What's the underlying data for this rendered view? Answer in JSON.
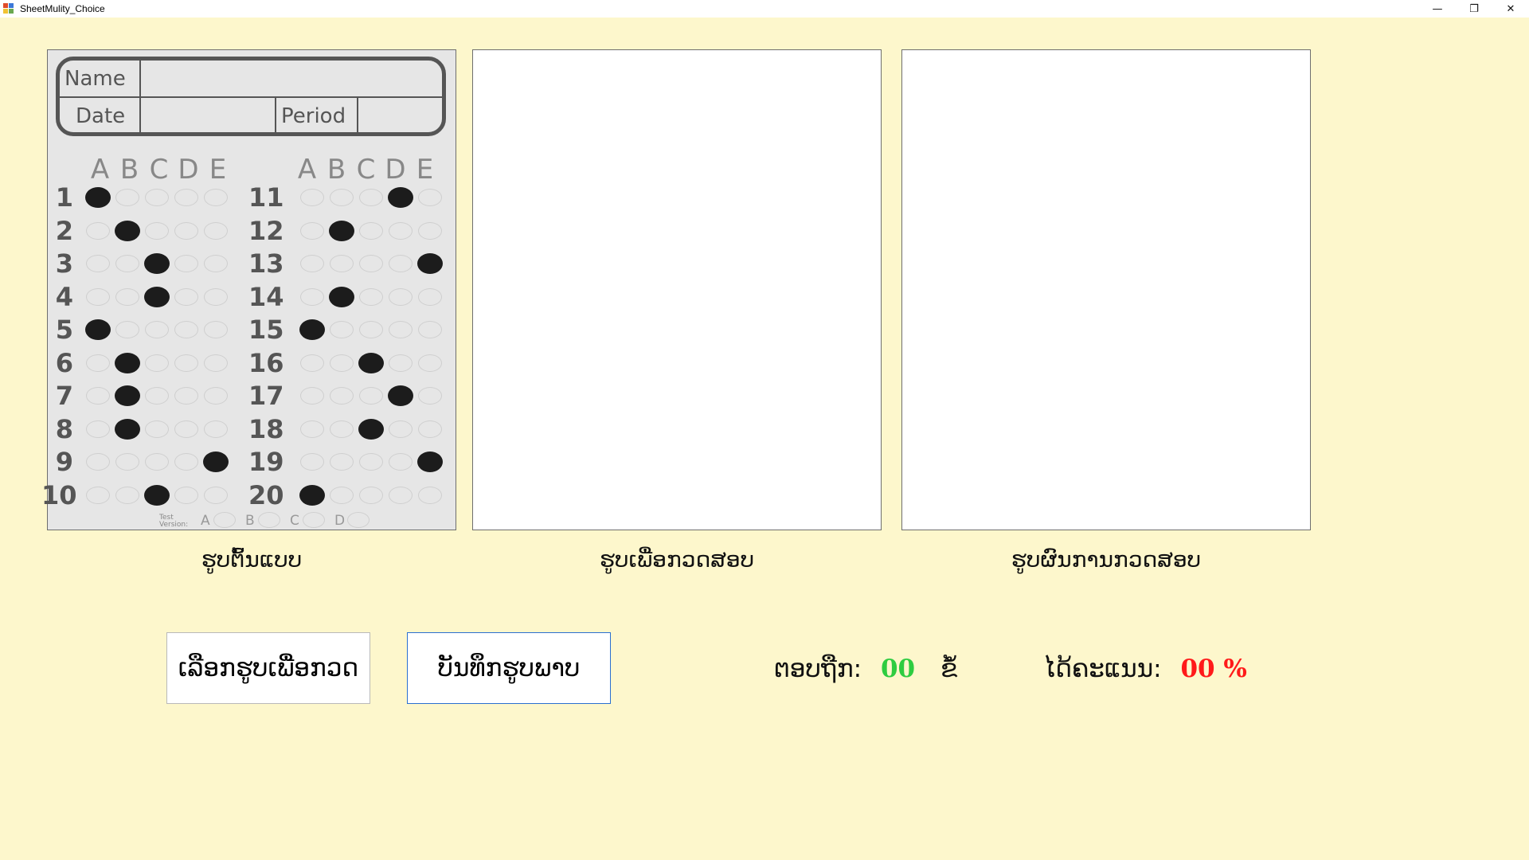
{
  "window": {
    "title": "SheetMulity_Choice"
  },
  "controls": {
    "minimize": "—",
    "restore": "❐",
    "close": "✕"
  },
  "sheet": {
    "name_label": "Name",
    "date_label": "Date",
    "period_label": "Period",
    "letters": [
      "A",
      "B",
      "C",
      "D",
      "E"
    ],
    "answers": [
      {
        "q": "1",
        "a": 0
      },
      {
        "q": "2",
        "a": 1
      },
      {
        "q": "3",
        "a": 2
      },
      {
        "q": "4",
        "a": 2
      },
      {
        "q": "5",
        "a": 0
      },
      {
        "q": "6",
        "a": 1
      },
      {
        "q": "7",
        "a": 1
      },
      {
        "q": "8",
        "a": 1
      },
      {
        "q": "9",
        "a": 4
      },
      {
        "q": "10",
        "a": 2
      },
      {
        "q": "11",
        "a": 3
      },
      {
        "q": "12",
        "a": 1
      },
      {
        "q": "13",
        "a": 4
      },
      {
        "q": "14",
        "a": 1
      },
      {
        "q": "15",
        "a": 0
      },
      {
        "q": "16",
        "a": 2
      },
      {
        "q": "17",
        "a": 3
      },
      {
        "q": "18",
        "a": 2
      },
      {
        "q": "19",
        "a": 4
      },
      {
        "q": "20",
        "a": 0
      }
    ],
    "version_label": "Test Version:",
    "version_letters": [
      "A",
      "B",
      "C",
      "D"
    ]
  },
  "captions": {
    "template": "ຮູບຕົ້ນແບບ",
    "check": "ຮູບເພື່ອກວດສອບ",
    "result": "ຮູບຜົນການກວດສອບ"
  },
  "buttons": {
    "select": "ເລືອກຮູບເພື່ອກວດ",
    "save": "ບັນທຶກຮູບພາບ"
  },
  "stats": {
    "correct_label": "ຕອບຖືກ:",
    "correct_value": "00",
    "correct_unit": "ຂໍ້",
    "score_label": "ໄດ້ຄະແນນ:",
    "score_value": "00 %"
  }
}
